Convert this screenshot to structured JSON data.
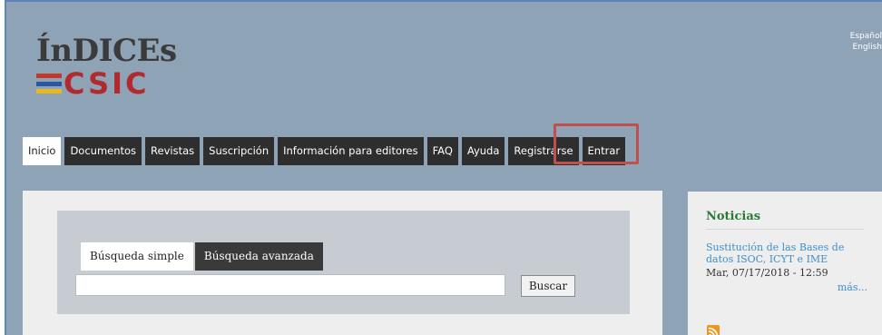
{
  "header": {
    "logo": {
      "line1": "ÍnDICEs",
      "line2": "CSIC",
      "flag_colors": [
        "#c0392b",
        "#2c56a0",
        "#e8b820"
      ]
    },
    "languages": [
      "Español",
      "English"
    ]
  },
  "nav": {
    "items": [
      {
        "label": "Inicio",
        "active": true
      },
      {
        "label": "Documentos"
      },
      {
        "label": "Revistas"
      },
      {
        "label": "Suscripción"
      },
      {
        "label": "Información para editores"
      },
      {
        "label": "FAQ"
      },
      {
        "label": "Ayuda"
      },
      {
        "label": "Registrarse",
        "highlighted": true
      },
      {
        "label": "Entrar"
      }
    ]
  },
  "search": {
    "tabs": [
      "Búsqueda simple",
      "Búsqueda avanzada"
    ],
    "input_value": "",
    "button_label": "Buscar"
  },
  "sidebar": {
    "title": "Noticias",
    "news_link": "Sustitución de las Bases de datos ISOC, ICYT e IME",
    "news_date": "Mar, 07/17/2018 - 12:59",
    "more": "más..."
  },
  "colors": {
    "header_bg": "#8ea3b5",
    "nav_bg": "#2e2e2e",
    "highlight": "#c0504d",
    "news_title": "#2c7a37",
    "link": "#3d8fc8",
    "rss": "#f29421"
  },
  "icons": {
    "rss": "rss-icon"
  }
}
